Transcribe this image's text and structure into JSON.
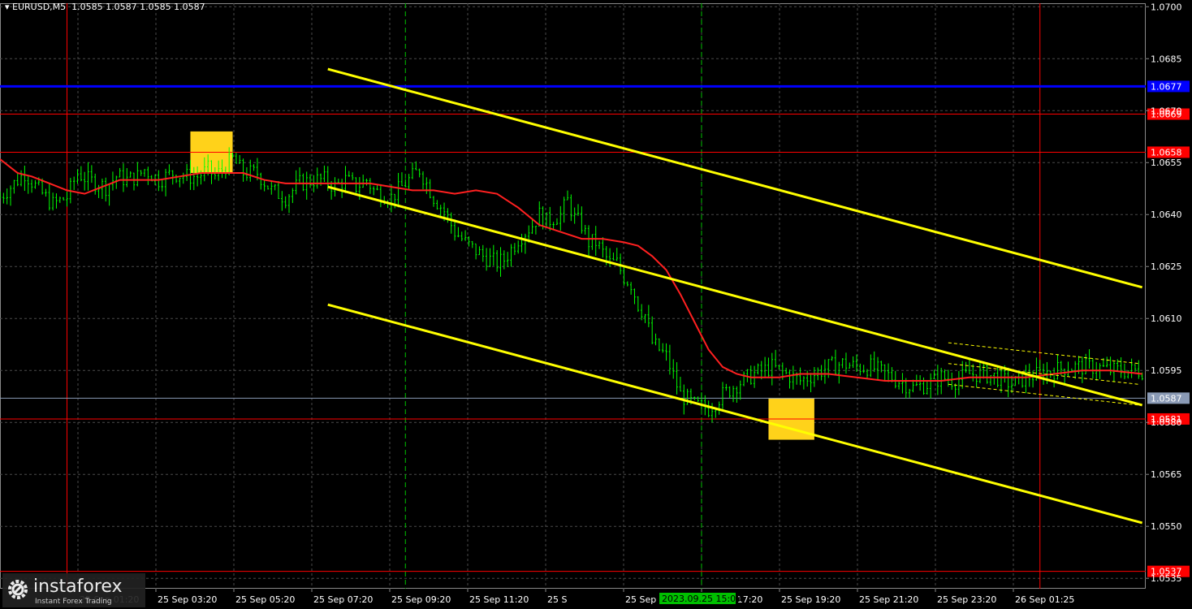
{
  "header": {
    "symbol": "EURUSD,M5",
    "ohlc": "1.0585 1.0587 1.0585 1.0587"
  },
  "watermark": {
    "brand": "instaforex",
    "tagline": "Instant Forex Trading"
  },
  "chart_data": {
    "type": "line",
    "price_ylim": [
      1.0532,
      1.0701
    ],
    "y_ticks": [
      "1.0700",
      "1.0685",
      "1.0670",
      "1.0655",
      "1.0640",
      "1.0625",
      "1.0610",
      "1.0595",
      "1.0580",
      "1.0565",
      "1.0550",
      "1.0535"
    ],
    "x_ticks": [
      "25 Sep 01:20",
      "25 Sep 03:20",
      "25 Sep 05:20",
      "25 Sep 07:20",
      "25 Sep 09:20",
      "25 Sep 11:20",
      "25 S",
      "25 Sep 15:20",
      "25 Sep 17:20",
      "25 Sep 19:20",
      "25 Sep 21:20",
      "25 Sep 23:20",
      "26 Sep 01:25"
    ],
    "cursor_time_label": "2023.09.25 15:00",
    "x_range_minutes": [
      -95,
      1530
    ],
    "price_series": {
      "t": [
        -95,
        -60,
        -40,
        -20,
        0,
        15,
        30,
        55,
        70,
        85,
        100,
        110,
        130,
        150,
        170,
        185,
        200,
        210,
        220,
        235,
        250,
        270,
        290,
        310,
        330,
        350,
        365,
        380,
        395,
        410,
        425,
        435,
        445,
        460,
        475,
        490,
        500,
        520,
        535,
        550,
        570,
        590,
        610,
        620,
        630,
        640,
        650,
        660,
        670,
        680,
        690,
        700,
        710,
        720,
        730,
        740,
        750,
        760,
        770,
        780,
        790,
        800,
        810,
        820,
        830,
        850,
        870,
        890,
        910,
        930,
        950,
        975,
        1000,
        1020,
        1040,
        1060,
        1080,
        1100,
        1120,
        1140,
        1160,
        1180,
        1200,
        1220,
        1240,
        1260,
        1280,
        1300,
        1320,
        1340,
        1360,
        1380,
        1400,
        1420,
        1440,
        1460,
        1480,
        1500,
        1525
      ],
      "close": [
        1.0645,
        1.0652,
        1.0647,
        1.0643,
        1.0645,
        1.0652,
        1.065,
        1.0648,
        1.0651,
        1.065,
        1.0651,
        1.0653,
        1.065,
        1.0652,
        1.0651,
        1.0651,
        1.0653,
        1.0651,
        1.0653,
        1.0656,
        1.0652,
        1.0652,
        1.0647,
        1.0645,
        1.0649,
        1.065,
        1.065,
        1.0648,
        1.065,
        1.0648,
        1.065,
        1.0647,
        1.0646,
        1.0645,
        1.0648,
        1.0651,
        1.0653,
        1.0645,
        1.0641,
        1.0635,
        1.0631,
        1.0628,
        1.0626,
        1.0627,
        1.063,
        1.0633,
        1.0635,
        1.0637,
        1.064,
        1.0638,
        1.0639,
        1.064,
        1.0644,
        1.0639,
        1.0637,
        1.0632,
        1.0632,
        1.0629,
        1.0626,
        1.0626,
        1.0622,
        1.062,
        1.0614,
        1.0611,
        1.0603,
        1.0599,
        1.0588,
        1.0585,
        1.0584,
        1.0588,
        1.0591,
        1.0594,
        1.0596,
        1.0594,
        1.0592,
        1.0594,
        1.0596,
        1.0597,
        1.0596,
        1.0596,
        1.0594,
        1.0592,
        1.059,
        1.0591,
        1.0593,
        1.0592,
        1.0594,
        1.0594,
        1.0593,
        1.0591,
        1.0593,
        1.0594,
        1.0595,
        1.0596,
        1.0596,
        1.0596,
        1.0595,
        1.0595,
        1.0595
      ]
    },
    "moving_average": {
      "t": [
        -95,
        -70,
        -50,
        -25,
        0,
        25,
        50,
        75,
        100,
        130,
        160,
        190,
        220,
        250,
        280,
        310,
        340,
        370,
        400,
        430,
        460,
        490,
        520,
        550,
        580,
        610,
        640,
        670,
        700,
        730,
        760,
        790,
        810,
        830,
        850,
        870,
        890,
        910,
        930,
        950,
        970,
        990,
        1010,
        1040,
        1080,
        1120,
        1160,
        1200,
        1240,
        1280,
        1320,
        1360,
        1400,
        1440,
        1480,
        1525
      ],
      "values": [
        1.0656,
        1.0652,
        1.0651,
        1.0649,
        1.0647,
        1.0646,
        1.0648,
        1.065,
        1.065,
        1.065,
        1.0651,
        1.0652,
        1.0652,
        1.0652,
        1.065,
        1.0649,
        1.0649,
        1.0649,
        1.0649,
        1.0649,
        1.0648,
        1.0647,
        1.0647,
        1.0646,
        1.0647,
        1.0646,
        1.0642,
        1.0637,
        1.0635,
        1.0633,
        1.0633,
        1.0632,
        1.0631,
        1.0628,
        1.0624,
        1.0617,
        1.0609,
        1.0601,
        1.0596,
        1.0594,
        1.0593,
        1.0593,
        1.0593,
        1.0594,
        1.0594,
        1.0593,
        1.0592,
        1.0592,
        1.0592,
        1.0593,
        1.0593,
        1.0593,
        1.0594,
        1.0595,
        1.0595,
        1.0594
      ]
    },
    "level_lines": [
      {
        "label": "1.0677",
        "price": 1.0677,
        "color": "#0000ff",
        "style": "thick"
      },
      {
        "label": "1.0669",
        "price": 1.0669,
        "color": "#ff0000",
        "style": "thin"
      },
      {
        "label": "1.0658",
        "price": 1.0658,
        "color": "#ff0000",
        "style": "thin"
      },
      {
        "label": "1.0587",
        "price": 1.0587,
        "color": "#8a9ab5",
        "style": "thin"
      },
      {
        "label": "1.0581",
        "price": 1.0581,
        "color": "#ff0000",
        "style": "thin"
      },
      {
        "label": "1.0537",
        "price": 1.0537,
        "color": "#ff0000",
        "style": "thin"
      }
    ],
    "vertical_lines": [
      {
        "t": 0,
        "color": "#ff0000",
        "style": "solid"
      },
      {
        "t": 480,
        "color": "#00c000",
        "style": "dashed"
      },
      {
        "t": 900,
        "color": "#00c000",
        "style": "dashed"
      },
      {
        "t": 1380,
        "color": "#ff0000",
        "style": "solid"
      }
    ],
    "channel_lines": [
      {
        "t1": 370,
        "p1": 1.0682,
        "t2": 1525,
        "p2": 1.0619,
        "color": "#ffff00"
      },
      {
        "t1": 370,
        "p1": 1.0648,
        "t2": 1525,
        "p2": 1.0585,
        "color": "#ffff00"
      },
      {
        "t1": 370,
        "p1": 1.0614,
        "t2": 1525,
        "p2": 1.0551,
        "color": "#ffff00"
      }
    ],
    "minor_channel_lines": [
      {
        "t1": 1250,
        "p1": 1.0603,
        "t2": 1520,
        "p2": 1.0597
      },
      {
        "t1": 1250,
        "p1": 1.0597,
        "t2": 1520,
        "p2": 1.0591
      },
      {
        "t1": 1250,
        "p1": 1.0591,
        "t2": 1520,
        "p2": 1.0585
      }
    ],
    "zones": [
      {
        "t1": 175,
        "t2": 235,
        "p1": 1.0652,
        "p2": 1.0664,
        "color": "#ffd21a"
      },
      {
        "t1": 995,
        "t2": 1060,
        "p1": 1.0575,
        "p2": 1.0587,
        "color": "#ffd21a"
      }
    ],
    "colors": {
      "candles": "#00ff00",
      "ma": "#ff2020",
      "grid": "#4a4a4a",
      "text": "#ffffff"
    }
  }
}
